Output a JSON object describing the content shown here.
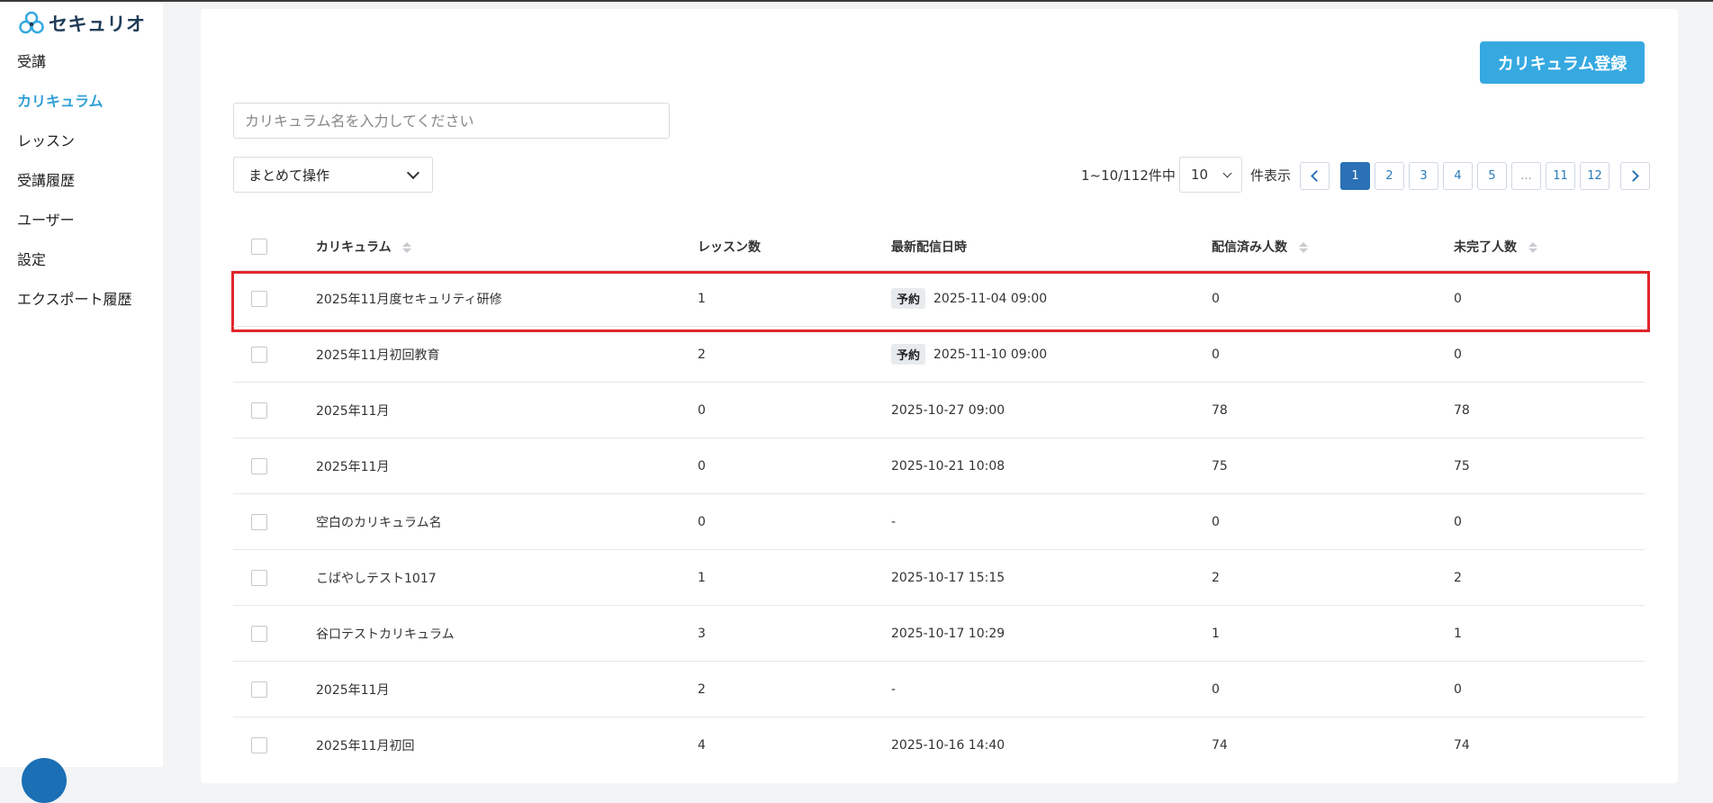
{
  "app": {
    "logo_text": "セキュリオ",
    "logo_color": "#1f3b57",
    "accent": "#2e9fd6"
  },
  "sidebar": {
    "items": [
      {
        "label": "受講",
        "active": false
      },
      {
        "label": "カリキュラム",
        "active": true
      },
      {
        "label": "レッスン",
        "active": false
      },
      {
        "label": "受講履歴",
        "active": false
      },
      {
        "label": "ユーザー",
        "active": false
      },
      {
        "label": "設定",
        "active": false
      },
      {
        "label": "エクスポート履歴",
        "active": false
      }
    ]
  },
  "main": {
    "register_button": "カリキュラム登録",
    "search_placeholder": "カリキュラム名を入力してください",
    "bulk_action": "まとめて操作",
    "pager": {
      "info": "1~10/112件中",
      "per_page": "10",
      "per_page_label": "件表示",
      "pages": [
        "1",
        "2",
        "3",
        "4",
        "5",
        "...",
        "11",
        "12"
      ],
      "current": "1"
    },
    "table": {
      "columns": [
        "カリキュラム",
        "レッスン数",
        "最新配信日時",
        "配信済み人数",
        "未完了人数"
      ],
      "rows": [
        {
          "name": "2025年11月度セキュリティ研修",
          "lessons": "1",
          "badge": "予約",
          "date": "2025-11-04 09:00",
          "sent": "0",
          "pending": "0"
        },
        {
          "name": "2025年11月初回教育",
          "lessons": "2",
          "badge": "予約",
          "date": "2025-11-10 09:00",
          "sent": "0",
          "pending": "0"
        },
        {
          "name": "2025年11月",
          "lessons": "0",
          "badge": "",
          "date": "2025-10-27 09:00",
          "sent": "78",
          "pending": "78"
        },
        {
          "name": "2025年11月",
          "lessons": "0",
          "badge": "",
          "date": "2025-10-21 10:08",
          "sent": "75",
          "pending": "75"
        },
        {
          "name": "空白のカリキュラム名",
          "lessons": "0",
          "badge": "",
          "date": "-",
          "sent": "0",
          "pending": "0"
        },
        {
          "name": "こばやしテスト1017",
          "lessons": "1",
          "badge": "",
          "date": "2025-10-17 15:15",
          "sent": "2",
          "pending": "2"
        },
        {
          "name": "谷口テストカリキュラム",
          "lessons": "3",
          "badge": "",
          "date": "2025-10-17 10:29",
          "sent": "1",
          "pending": "1"
        },
        {
          "name": "2025年11月",
          "lessons": "2",
          "badge": "",
          "date": "-",
          "sent": "0",
          "pending": "0"
        },
        {
          "name": "2025年11月初回",
          "lessons": "4",
          "badge": "",
          "date": "2025-10-16 14:40",
          "sent": "74",
          "pending": "74"
        }
      ]
    }
  }
}
